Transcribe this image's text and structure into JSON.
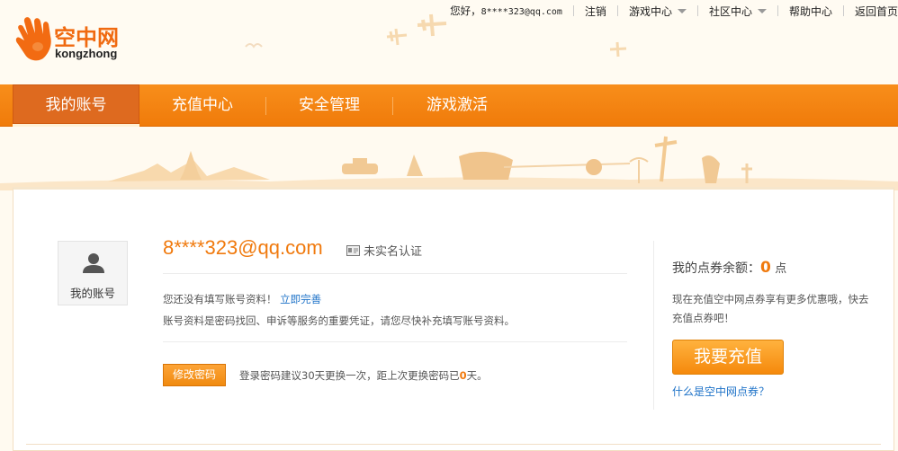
{
  "brand": {
    "name_cn": "空中网",
    "name_en": "kongzhong"
  },
  "top_links": {
    "greeting": "您好，",
    "account": "8****323@qq.com",
    "logout": "注销",
    "game_center": "游戏中心",
    "community": "社区中心",
    "help": "帮助中心",
    "home": "返回首页"
  },
  "nav": {
    "items": [
      {
        "label": "我的账号"
      },
      {
        "label": "充值中心"
      },
      {
        "label": "安全管理"
      },
      {
        "label": "游戏激活"
      }
    ]
  },
  "account": {
    "avatar_label": "我的账号",
    "email": "8****323@qq.com",
    "realname_status": "未实名认证",
    "info_prompt": "您还没有填写账号资料！",
    "info_link": "立即完善",
    "info_note": "账号资料是密码找回、申诉等服务的重要凭证，请您尽快补充填写账号资料。",
    "change_pwd_button": "修改密码",
    "pwd_tip_prefix": "登录密码建议30天更换一次，距上次更换密码已",
    "pwd_days": "0",
    "pwd_tip_suffix": "天。"
  },
  "balance": {
    "label": "我的点券余额：",
    "amount": "0",
    "unit": "点",
    "promo": "现在充值空中网点券享有更多优惠哦，快去充值点券吧！",
    "recharge_button": "我要充值",
    "what_link": "什么是空中网点券？"
  },
  "colors": {
    "accent": "#f07a0e",
    "nav_bg": "#f5850f",
    "link": "#1f73c8"
  }
}
